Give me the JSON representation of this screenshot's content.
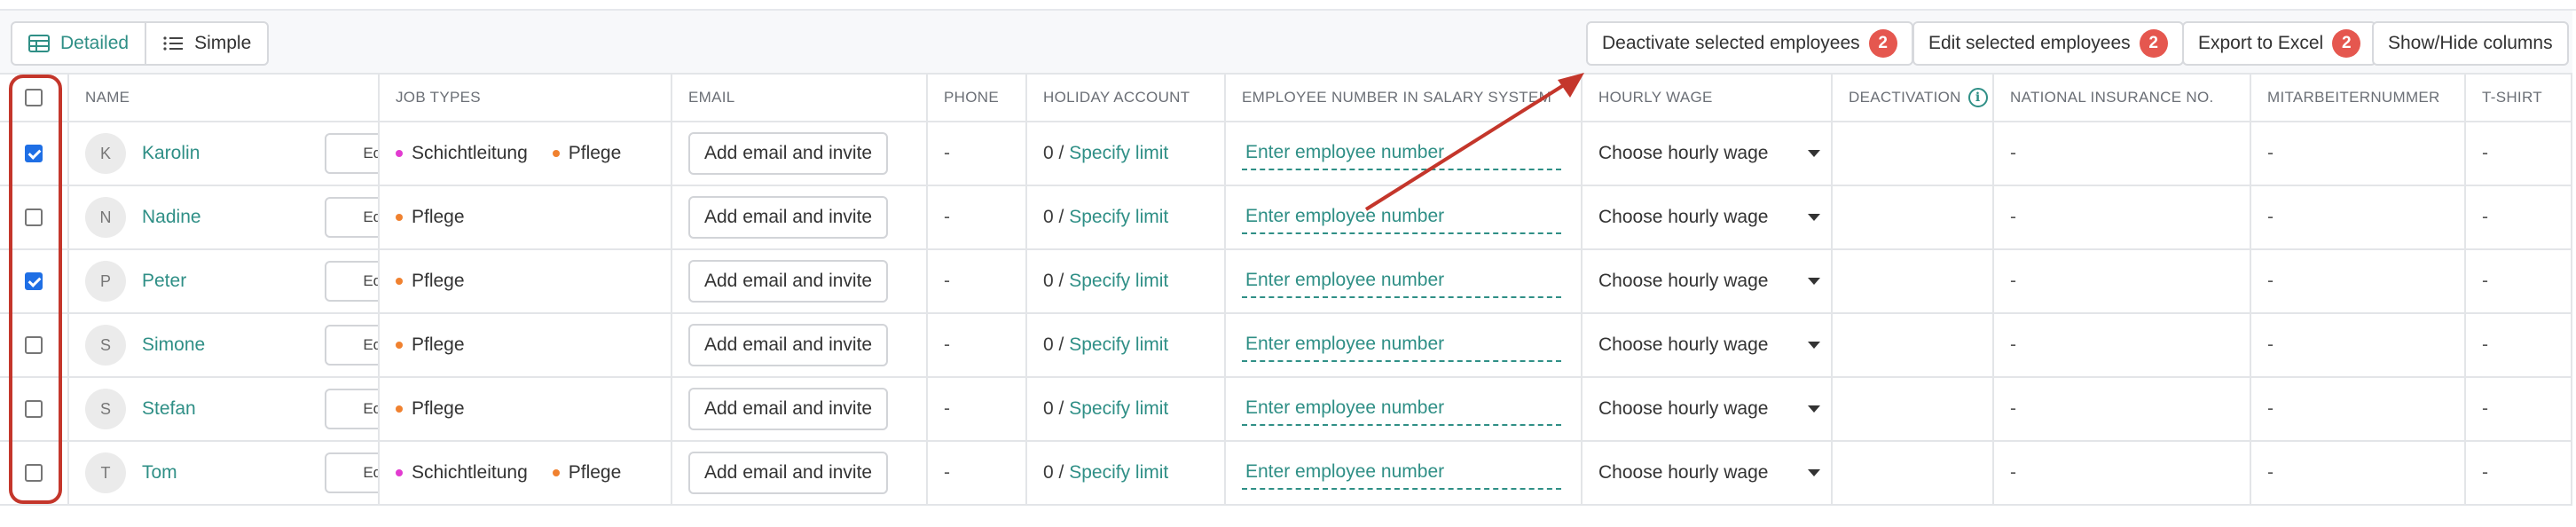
{
  "toolbar": {
    "view_detailed": "Detailed",
    "view_simple": "Simple",
    "deactivate_label": "Deactivate selected employees",
    "deactivate_count": "2",
    "edit_label": "Edit selected employees",
    "edit_count": "2",
    "export_label": "Export to Excel",
    "export_count": "2",
    "showhide_label": "Show/Hide columns"
  },
  "columns": {
    "name": "NAME",
    "job_types": "JOB TYPES",
    "email": "EMAIL",
    "phone": "PHONE",
    "holiday": "HOLIDAY ACCOUNT",
    "empnum": "EMPLOYEE NUMBER IN SALARY SYSTEM",
    "wage": "HOURLY WAGE",
    "deactivation": "DEACTIVATION",
    "nin": "NATIONAL INSURANCE NO.",
    "mitarbeiternummer": "MITARBEITERNUMMER",
    "tshirt": "T-SHIRT"
  },
  "colors": {
    "accent": "#2f8f86",
    "badge": "#e5574f",
    "schichtleitung_dot": "#e23bd0",
    "pflege_dot": "#f0812f",
    "annotation": "#c4362b",
    "checkbox": "#1f6fe5"
  },
  "rows": [
    {
      "initial": "K",
      "name": "Karolin",
      "checked": true,
      "job_types": [
        {
          "label": "Schichtleitung",
          "color": "#e23bd0"
        },
        {
          "label": "Pflege",
          "color": "#f0812f"
        }
      ],
      "edit": "Edit",
      "email_action": "Add email and invite",
      "phone": "-",
      "holiday_value": "0 /",
      "holiday_link": "Specify limit",
      "empnum_placeholder": "Enter employee number",
      "wage": "Choose hourly wage",
      "nin": "-",
      "mitarbeiternummer": "-",
      "tshirt": "-"
    },
    {
      "initial": "N",
      "name": "Nadine",
      "checked": false,
      "job_types": [
        {
          "label": "Pflege",
          "color": "#f0812f"
        }
      ],
      "edit": "Edit",
      "email_action": "Add email and invite",
      "phone": "-",
      "holiday_value": "0 /",
      "holiday_link": "Specify limit",
      "empnum_placeholder": "Enter employee number",
      "wage": "Choose hourly wage",
      "nin": "-",
      "mitarbeiternummer": "-",
      "tshirt": "-"
    },
    {
      "initial": "P",
      "name": "Peter",
      "checked": true,
      "job_types": [
        {
          "label": "Pflege",
          "color": "#f0812f"
        }
      ],
      "edit": "Edit",
      "email_action": "Add email and invite",
      "phone": "-",
      "holiday_value": "0 /",
      "holiday_link": "Specify limit",
      "empnum_placeholder": "Enter employee number",
      "wage": "Choose hourly wage",
      "nin": "-",
      "mitarbeiternummer": "-",
      "tshirt": "-"
    },
    {
      "initial": "S",
      "name": "Simone",
      "checked": false,
      "job_types": [
        {
          "label": "Pflege",
          "color": "#f0812f"
        }
      ],
      "edit": "Edit",
      "email_action": "Add email and invite",
      "phone": "-",
      "holiday_value": "0 /",
      "holiday_link": "Specify limit",
      "empnum_placeholder": "Enter employee number",
      "wage": "Choose hourly wage",
      "nin": "-",
      "mitarbeiternummer": "-",
      "tshirt": "-"
    },
    {
      "initial": "S",
      "name": "Stefan",
      "checked": false,
      "job_types": [
        {
          "label": "Pflege",
          "color": "#f0812f"
        }
      ],
      "edit": "Edit",
      "email_action": "Add email and invite",
      "phone": "-",
      "holiday_value": "0 /",
      "holiday_link": "Specify limit",
      "empnum_placeholder": "Enter employee number",
      "wage": "Choose hourly wage",
      "nin": "-",
      "mitarbeiternummer": "-",
      "tshirt": "-"
    },
    {
      "initial": "T",
      "name": "Tom",
      "checked": false,
      "job_types": [
        {
          "label": "Schichtleitung",
          "color": "#e23bd0"
        },
        {
          "label": "Pflege",
          "color": "#f0812f"
        }
      ],
      "edit": "Edit",
      "email_action": "Add email and invite",
      "phone": "-",
      "holiday_value": "0 /",
      "holiday_link": "Specify limit",
      "empnum_placeholder": "Enter employee number",
      "wage": "Choose hourly wage",
      "nin": "-",
      "mitarbeiternummer": "-",
      "tshirt": "-"
    }
  ]
}
